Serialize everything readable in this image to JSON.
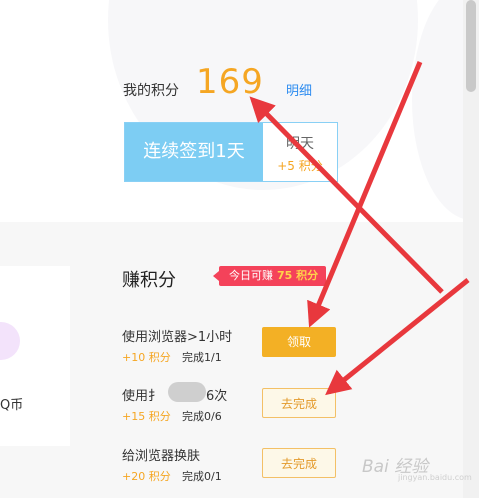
{
  "points": {
    "label": "我的积分",
    "value": "169",
    "detail_link": "明细"
  },
  "checkin": {
    "button_label": "连续签到1天",
    "tomorrow_label": "明天",
    "tomorrow_points": "+5 积分"
  },
  "earn": {
    "title": "赚积分",
    "badge_text": "今日可赚",
    "badge_points": "75 积分"
  },
  "side_card": {
    "coin_text": "Q币"
  },
  "tasks": [
    {
      "name": "使用浏览器>1小时",
      "points": "+10 积分",
      "progress": "完成1/1",
      "action": "领取"
    },
    {
      "name_prefix": "使用扌",
      "name_suffix": "6次",
      "points": "+15 积分",
      "progress": "完成0/6",
      "action": "去完成"
    },
    {
      "name": "给浏览器换肤",
      "points": "+20 积分",
      "progress": "完成0/1",
      "action": "去完成"
    }
  ],
  "watermark": {
    "main": "Bai 经验",
    "sub": "jingyan.baidu.com"
  },
  "colors": {
    "accent_orange": "#f5a623",
    "checkin_blue": "#7dcdf3",
    "badge_red": "#f4425a",
    "link_blue": "#2d8cf0",
    "annotation_red": "#e8383d"
  }
}
